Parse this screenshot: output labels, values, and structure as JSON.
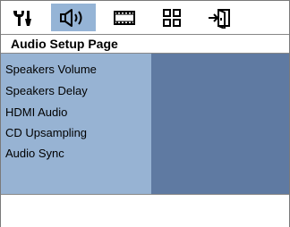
{
  "header": {
    "tabs": [
      {
        "name": "general-setup",
        "icon": "tools-icon",
        "selected": false
      },
      {
        "name": "audio-setup",
        "icon": "speaker-icon",
        "selected": true
      },
      {
        "name": "video-setup",
        "icon": "film-icon",
        "selected": false
      },
      {
        "name": "preference-setup",
        "icon": "grid-icon",
        "selected": false
      },
      {
        "name": "exit",
        "icon": "exit-icon",
        "selected": false
      }
    ],
    "title": "Audio Setup Page"
  },
  "menu": {
    "items": [
      {
        "label": "Speakers Volume"
      },
      {
        "label": "Speakers Delay"
      },
      {
        "label": "HDMI Audio"
      },
      {
        "label": "CD Upsampling"
      },
      {
        "label": "Audio Sync"
      }
    ]
  },
  "colors": {
    "selected_tab": "#95b4d6",
    "menu_panel": "#97b3d3",
    "options_panel": "#5f7aa2"
  }
}
